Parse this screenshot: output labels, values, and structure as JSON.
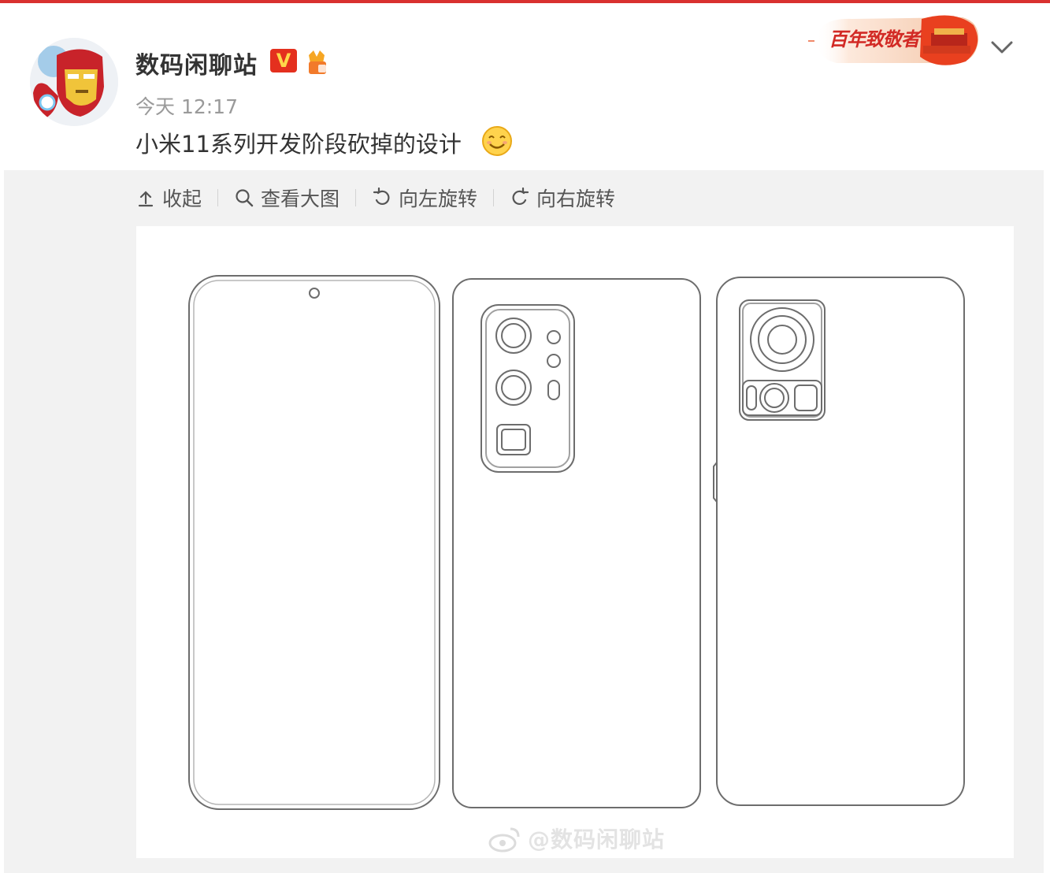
{
  "post": {
    "username": "数码闲聊站",
    "vip_badge_text": "V",
    "timestamp": "今天 12:17",
    "text": "小米11系列开发阶段砍掉的设计",
    "emoji_icon": "smile-emoji-icon",
    "banner_text": "百年致敬者"
  },
  "toolbar": {
    "collapse_label": "收起",
    "view_large_label": "查看大图",
    "rotate_left_label": "向左旋转",
    "rotate_right_label": "向右旋转"
  },
  "image": {
    "watermark": "@数码闲聊站"
  },
  "colors": {
    "accent_red": "#d9312f",
    "vip_red": "#e4301e",
    "text_primary": "#333333",
    "text_muted": "#9a9a9a",
    "media_bg": "#f2f2f2"
  }
}
